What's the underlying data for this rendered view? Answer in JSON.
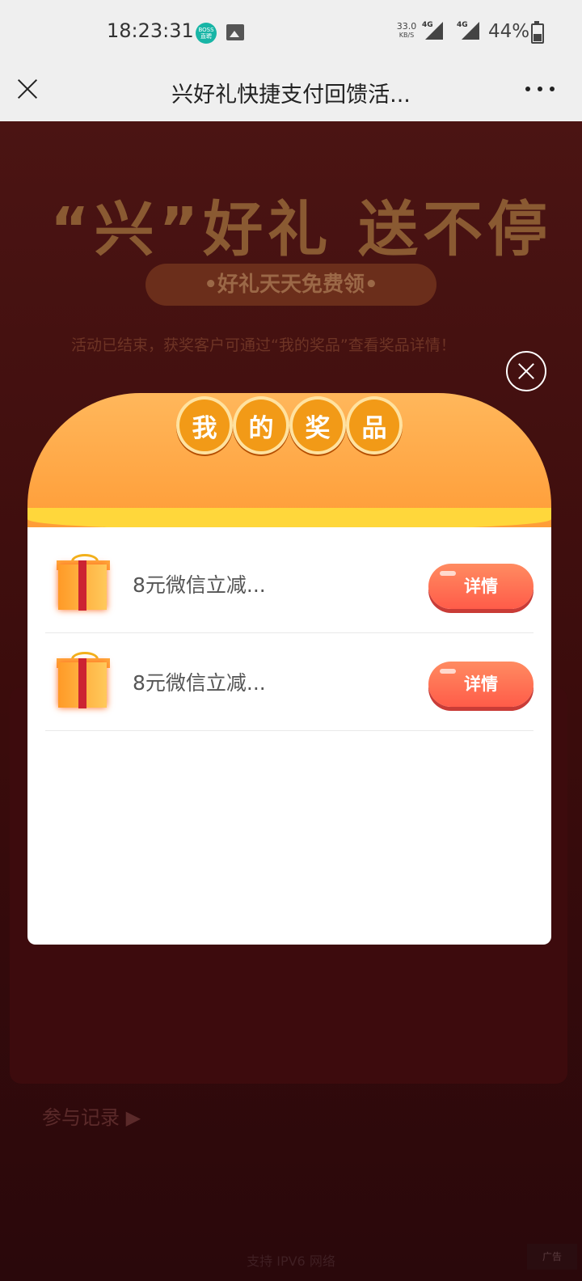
{
  "status": {
    "time": "18:23:31",
    "boss_icon_text": "BOSS 直聘",
    "speed_value": "33.0",
    "speed_unit": "KB/S",
    "network_label_1": "4G",
    "network_label_2": "4G",
    "battery": "44%"
  },
  "nav": {
    "title": "兴好礼快捷支付回馈活...",
    "close_icon": "close-icon",
    "more_icon": "more-icon"
  },
  "background": {
    "title": "“兴”好礼 送不停",
    "subtitle": "•好礼天天免费领•",
    "notice": "活动已结束，获奖客户可通过“我的奖品”查看奖品详情！",
    "record_link": "参与记录 ▶",
    "footer": "支持 IPV6 网络",
    "ad_label": "广告"
  },
  "modal": {
    "badges": [
      "我",
      "的",
      "奖",
      "品"
    ],
    "prizes": [
      {
        "name": "8元微信立减...",
        "button": "详情"
      },
      {
        "name": "8元微信立减...",
        "button": "详情"
      }
    ]
  }
}
